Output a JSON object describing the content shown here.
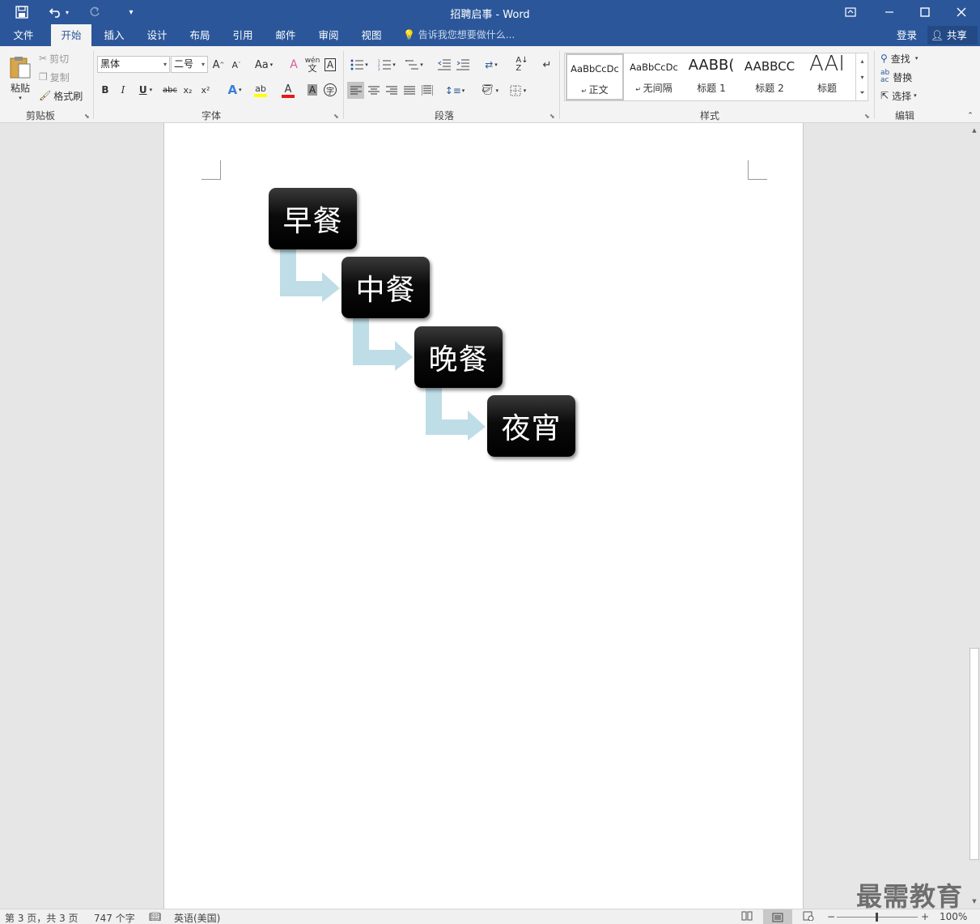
{
  "window": {
    "title": "招聘启事 - Word",
    "controls": [
      "restore-ribbon",
      "minimize",
      "maximize",
      "close"
    ]
  },
  "quick_access": {
    "save_icon": "save-icon",
    "undo_icon": "undo-icon",
    "redo_icon": "redo-icon",
    "customize_icon": "customize-qat-icon"
  },
  "tabs": [
    "文件",
    "开始",
    "插入",
    "设计",
    "布局",
    "引用",
    "邮件",
    "审阅",
    "视图"
  ],
  "active_tab": "开始",
  "tell_me": "告诉我您想要做什么...",
  "account": {
    "login": "登录",
    "share": "共享"
  },
  "ribbon": {
    "clipboard": {
      "label": "剪贴板",
      "paste": "粘贴",
      "cut": "剪切",
      "copy": "复制",
      "format_painter": "格式刷"
    },
    "font": {
      "label": "字体",
      "font_name": "黑体",
      "font_size": "二号",
      "change_case": "Aa",
      "bold": "B",
      "italic": "I",
      "underline": "U",
      "strikethrough": "abc",
      "subscript": "x₂",
      "superscript": "x²",
      "highlight_color": "#ffff00",
      "font_color": "#e31b1b"
    },
    "paragraph": {
      "label": "段落"
    },
    "styles": {
      "label": "样式",
      "items": [
        {
          "sample": "AaBbCcDc",
          "name": "正文"
        },
        {
          "sample": "AaBbCcDc",
          "name": "无间隔"
        },
        {
          "sample": "AABB(",
          "name": "标题 1"
        },
        {
          "sample": "AABBCC",
          "name": "标题 2"
        },
        {
          "sample": "AAI",
          "name": "标题"
        }
      ]
    },
    "editing": {
      "label": "编辑",
      "find": "查找",
      "replace": "替换",
      "select": "选择"
    }
  },
  "document": {
    "smartart": [
      "早餐",
      "中餐",
      "晚餐",
      "夜宵"
    ],
    "smartart_box_color": "#000000",
    "smartart_arrow_color": "#bfdde6"
  },
  "status": {
    "page": "第 3 页，共 3 页",
    "words": "747 个字",
    "language": "英语(美国)",
    "zoom": "100%"
  },
  "watermark": "最需教育"
}
